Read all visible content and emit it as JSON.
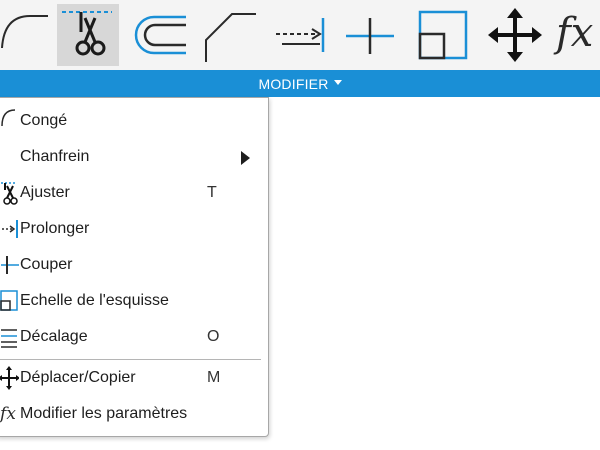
{
  "panel": {
    "title": "MODIFIER",
    "accent_color": "#1a8fd6"
  },
  "toolbar": {
    "tools": [
      {
        "icon": "fillet-icon",
        "active": false
      },
      {
        "icon": "trim-icon",
        "active": true
      },
      {
        "icon": "offset-icon",
        "active": false
      },
      {
        "icon": "chamfer-icon",
        "active": false
      },
      {
        "icon": "extend-icon",
        "active": false
      },
      {
        "icon": "break-icon",
        "active": false
      },
      {
        "icon": "sketch-scale-icon",
        "active": false
      },
      {
        "icon": "move-copy-icon",
        "active": false
      },
      {
        "icon": "change-parameters-icon",
        "active": false
      }
    ]
  },
  "menu": {
    "items": [
      {
        "label": "Congé",
        "shortcut": "",
        "icon": "fillet-icon"
      },
      {
        "label": "Chanfrein",
        "shortcut": "",
        "icon": "chamfer-icon",
        "has_submenu": true
      },
      {
        "label": "Ajuster",
        "shortcut": "T",
        "icon": "trim-icon"
      },
      {
        "label": "Prolonger",
        "shortcut": "",
        "icon": "extend-icon"
      },
      {
        "label": "Couper",
        "shortcut": "",
        "icon": "break-icon"
      },
      {
        "label": "Echelle de l'esquisse",
        "shortcut": "",
        "icon": "sketch-scale-icon"
      },
      {
        "label": "Décalage",
        "shortcut": "O",
        "icon": "offset-icon"
      },
      {
        "label": "Déplacer/Copier",
        "shortcut": "M",
        "icon": "move-copy-icon"
      },
      {
        "label": "Modifier les paramètres",
        "shortcut": "",
        "icon": "change-parameters-icon"
      }
    ]
  }
}
